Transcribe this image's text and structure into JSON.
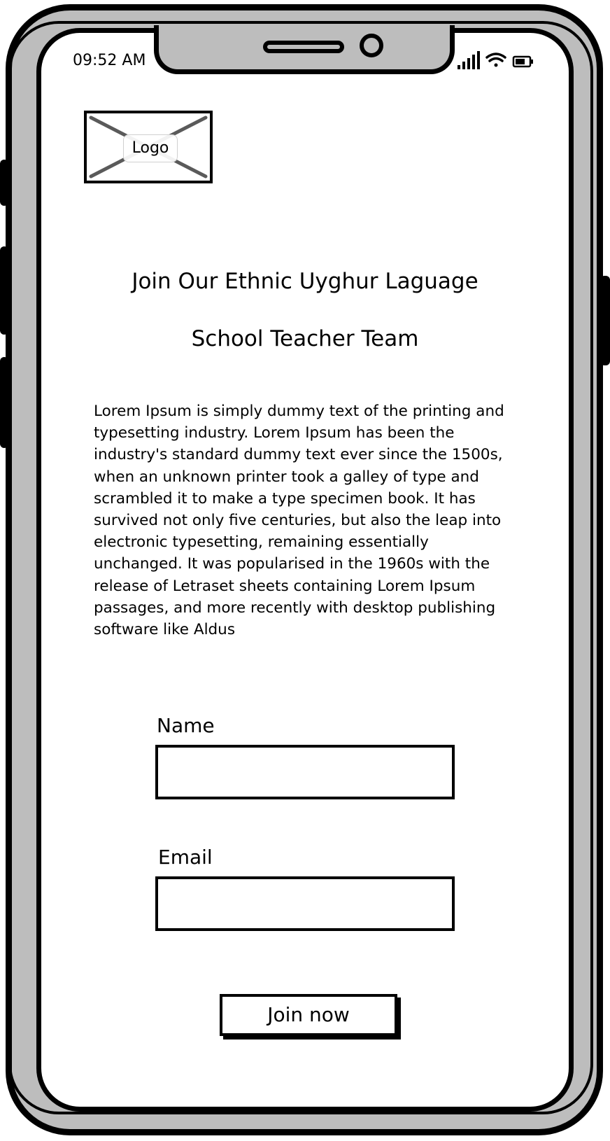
{
  "status_bar": {
    "time": "09:52 AM"
  },
  "logo": {
    "label": "Logo"
  },
  "hero": {
    "title_line1": "Join Our Ethnic Uyghur Laguage",
    "title_line2": "School Teacher Team",
    "body": "Lorem Ipsum is simply dummy text of the printing and typesetting industry. Lorem Ipsum has been the industry's standard dummy text ever since the 1500s, when an unknown printer took a galley of type and scrambled it to make a type specimen book. It has survived not only five centuries, but also the leap into electronic typesetting, remaining essentially unchanged. It was popularised in the 1960s with the release of Letraset sheets containing Lorem Ipsum passages, and more recently with desktop publishing software like Aldus"
  },
  "form": {
    "name_label": "Name",
    "name_value": "",
    "email_label": "Email",
    "email_value": "",
    "submit_label": "Join now"
  },
  "icons": {
    "signal": "cellular-signal-icon",
    "wifi": "wifi-icon",
    "battery": "battery-icon",
    "logo_placeholder": "image-placeholder-icon"
  },
  "colors": {
    "frame": "#bdbdbd",
    "ink": "#000000",
    "screen": "#ffffff"
  }
}
